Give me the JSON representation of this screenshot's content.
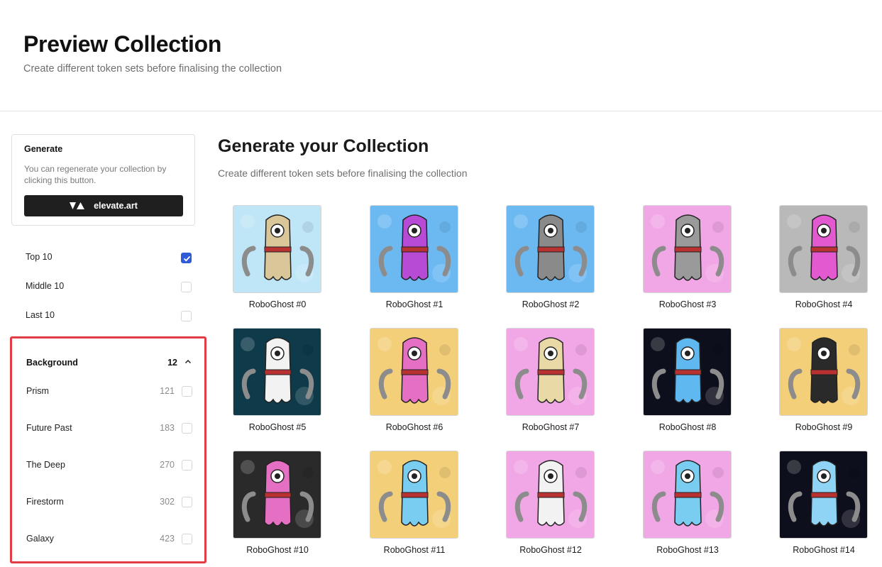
{
  "header": {
    "title": "Preview Collection",
    "subtitle": "Create different token sets before finalising the collection"
  },
  "generate": {
    "title": "Generate",
    "description": "You can regenerate your collection by clicking this button.",
    "button_label": "elevate.art"
  },
  "rank_filters": [
    {
      "label": "Top 10",
      "checked": true
    },
    {
      "label": "Middle 10",
      "checked": false
    },
    {
      "label": "Last 10",
      "checked": false
    }
  ],
  "trait_filter": {
    "name": "Background",
    "count": "12",
    "options": [
      {
        "label": "Prism",
        "count": "121",
        "checked": false
      },
      {
        "label": "Future Past",
        "count": "183",
        "checked": false
      },
      {
        "label": "The Deep",
        "count": "270",
        "checked": false
      },
      {
        "label": "Firestorm",
        "count": "302",
        "checked": false
      },
      {
        "label": "Galaxy",
        "count": "423",
        "checked": false
      }
    ]
  },
  "main": {
    "title": "Generate your Collection",
    "subtitle": "Create different token sets before finalising the collection"
  },
  "tokens": [
    {
      "name": "RoboGhost #0",
      "bg": "#bfe6f7",
      "body": "#d9c79a"
    },
    {
      "name": "RoboGhost #1",
      "bg": "#6cb9f2",
      "body": "#b84bd6"
    },
    {
      "name": "RoboGhost #2",
      "bg": "#6cb9f2",
      "body": "#8a8a8a"
    },
    {
      "name": "RoboGhost #3",
      "bg": "#f1a6e6",
      "body": "#9a9a9a"
    },
    {
      "name": "RoboGhost #4",
      "bg": "#b9b9b9",
      "body": "#e35ad0"
    },
    {
      "name": "RoboGhost #5",
      "bg": "#0e3a4a",
      "body": "#f2f2f2"
    },
    {
      "name": "RoboGhost #6",
      "bg": "#f4cf7a",
      "body": "#e46fc3"
    },
    {
      "name": "RoboGhost #7",
      "bg": "#f1a6e6",
      "body": "#e9d9a6"
    },
    {
      "name": "RoboGhost #8",
      "bg": "#0d0f1c",
      "body": "#5fb8ef"
    },
    {
      "name": "RoboGhost #9",
      "bg": "#f4cf7a",
      "body": "#2a2a2a"
    },
    {
      "name": "RoboGhost #10",
      "bg": "#2a2a2a",
      "body": "#e46fc3"
    },
    {
      "name": "RoboGhost #11",
      "bg": "#f4cf7a",
      "body": "#79cdf1"
    },
    {
      "name": "RoboGhost #12",
      "bg": "#f1a6e6",
      "body": "#f2f2f2"
    },
    {
      "name": "RoboGhost #13",
      "bg": "#f1a6e6",
      "body": "#79cdf1"
    },
    {
      "name": "RoboGhost #14",
      "bg": "#0d0f1c",
      "body": "#8fd3f5"
    }
  ]
}
